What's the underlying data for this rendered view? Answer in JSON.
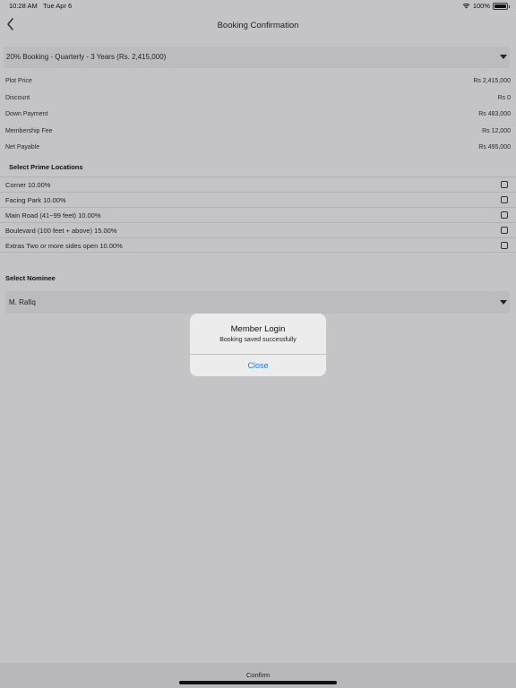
{
  "status_bar": {
    "time": "10:28 AM",
    "date": "Tue Apr 6",
    "battery": "100%"
  },
  "nav": {
    "title": "Booking Confirmation"
  },
  "plan_dropdown": {
    "selected": "20% Booking - Quarterly - 3 Years (Rs. 2,415,000)"
  },
  "summary": [
    {
      "label": "Plot Price",
      "value": "Rs 2,415,000"
    },
    {
      "label": "Discount",
      "value": "Rs 0"
    },
    {
      "label": "Down Payment",
      "value": "Rs 483,000"
    },
    {
      "label": "Membership Fee",
      "value": "Rs 12,000"
    },
    {
      "label": "Net Payable",
      "value": "Rs 495,000"
    }
  ],
  "prime_locations": {
    "title": "Select Prime Locations",
    "items": [
      {
        "label": "Corner 10.00%"
      },
      {
        "label": "Facing Park 10.00%"
      },
      {
        "label": "Main Road (41~99 feet) 10.00%"
      },
      {
        "label": "Boulevard (100 feet + above) 15.00%"
      },
      {
        "label": "Extras Two or more sides open 10.00%"
      }
    ]
  },
  "nominee": {
    "title": "Select Nominee",
    "selected": "M. Rafiq"
  },
  "alert": {
    "title": "Member Login",
    "message": "Booking saved successfully",
    "button": "Close"
  },
  "footer": {
    "confirm_label": "Confirm"
  },
  "colors": {
    "accent": "#1a7ae6",
    "background": "#c4c4c6"
  }
}
